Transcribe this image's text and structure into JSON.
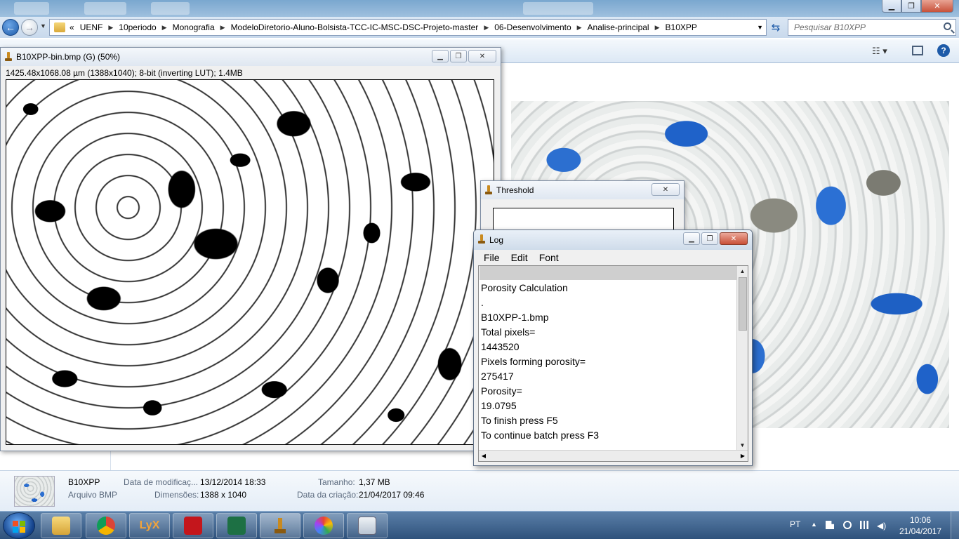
{
  "explorer": {
    "breadcrumb": [
      "UENF",
      "10periodo",
      "Monografia",
      "ModeloDiretorio-Aluno-Bolsista-TCC-IC-MSC-DSC-Projeto-master",
      "06-Desenvolvimento",
      "Analise-principal",
      "B10XPP"
    ],
    "search_placeholder": "Pesquisar B10XPP",
    "breadcrumb_overflow": "«"
  },
  "image_window": {
    "title": "B10XPP-bin.bmp (G) (50%)",
    "info": "1425.48x1068.08 µm (1388x1040); 8-bit (inverting LUT); 1.4MB"
  },
  "threshold_window": {
    "title": "Threshold"
  },
  "log_window": {
    "title": "Log",
    "menu": [
      "File",
      "Edit",
      "Font"
    ],
    "lines": [
      "Porosity Calculation",
      ".",
      "B10XPP-1.bmp",
      "Total pixels=",
      "1443520",
      "Pixels forming porosity=",
      "275417",
      "Porosity=",
      "19.0795",
      "To finish press F5",
      "To continue batch press F3"
    ]
  },
  "details": {
    "filename": "B10XPP",
    "filetype": "Arquivo BMP",
    "modified_label": "Data de modificaç...",
    "modified_value": "13/12/2014 18:33",
    "dimensions_label": "Dimensões:",
    "dimensions_value": "1388 x 1040",
    "size_label": "Tamanho:",
    "size_value": "1,37 MB",
    "created_label": "Data da criação:",
    "created_value": "21/04/2017 09:46"
  },
  "taskbar": {
    "language": "PT",
    "time": "10:06",
    "date": "21/04/2017"
  },
  "colors": {
    "pore_blue": "#1f62c9",
    "taskbar_top": "#5a7fa8",
    "taskbar_bottom": "#2f527c"
  }
}
